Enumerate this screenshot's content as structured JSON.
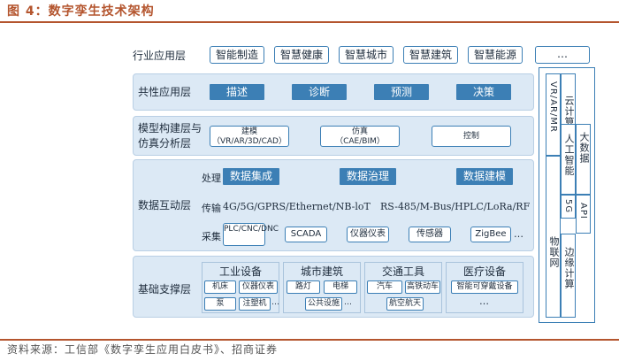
{
  "title": "图 4：数字孪生技术架构",
  "source": "资料来源：工信部《数字孪生应用白皮书》、招商证券",
  "layers": {
    "industry": {
      "label": "行业应用层",
      "items": [
        "智能制造",
        "智慧健康",
        "智慧城市",
        "智慧建筑",
        "智慧能源",
        "…"
      ]
    },
    "common": {
      "label": "共性应用层",
      "items": [
        "描述",
        "诊断",
        "预测",
        "决策"
      ]
    },
    "model": {
      "label_line1": "模型构建层与",
      "label_line2": "仿真分析层",
      "box1_line1": "建模",
      "box1_line2": "（VR/AR/3D/CAD）",
      "box2_line1": "仿真",
      "box2_line2": "（CAE/BIM）",
      "box3": "控制"
    },
    "data": {
      "label": "数据互动层",
      "process_label": "处理",
      "process_items": [
        "数据集成",
        "数据治理",
        "数据建模"
      ],
      "transmit_label": "传输",
      "transmit_left": "4G/5G/GPRS/Ethernet/NB-loT",
      "transmit_right": "RS-485/M-Bus/HPLC/LoRa/RF",
      "collect_label": "采集",
      "collect_items": [
        "PLC/CNC/DNC",
        "SCADA",
        "仪器仪表",
        "传感器",
        "ZigBee"
      ],
      "collect_more": "…"
    },
    "base": {
      "label": "基础支撑层",
      "groups": [
        {
          "title": "工业设备",
          "row1": [
            "机床",
            "仪器仪表"
          ],
          "row2": [
            "泵",
            "注塑机"
          ],
          "more": "…"
        },
        {
          "title": "城市建筑",
          "row1": [
            "路灯",
            "电梯"
          ],
          "row2": [
            "公共设施"
          ],
          "more": "…"
        },
        {
          "title": "交通工具",
          "row1": [
            "汽车",
            "高铁动车"
          ],
          "row2": [
            "航空航天"
          ],
          "more": "…"
        },
        {
          "title": "医疗设备",
          "row1": [
            "智能可穿戴设备"
          ],
          "row2": [],
          "more": "…"
        }
      ]
    }
  },
  "side": {
    "vr": "VR/AR/MR",
    "cloud": "云计算",
    "ai": "人工智能",
    "bigdata": "大数据",
    "fiveg": "5G",
    "api": "API",
    "iot": "物联网",
    "edge": "边缘计算"
  }
}
